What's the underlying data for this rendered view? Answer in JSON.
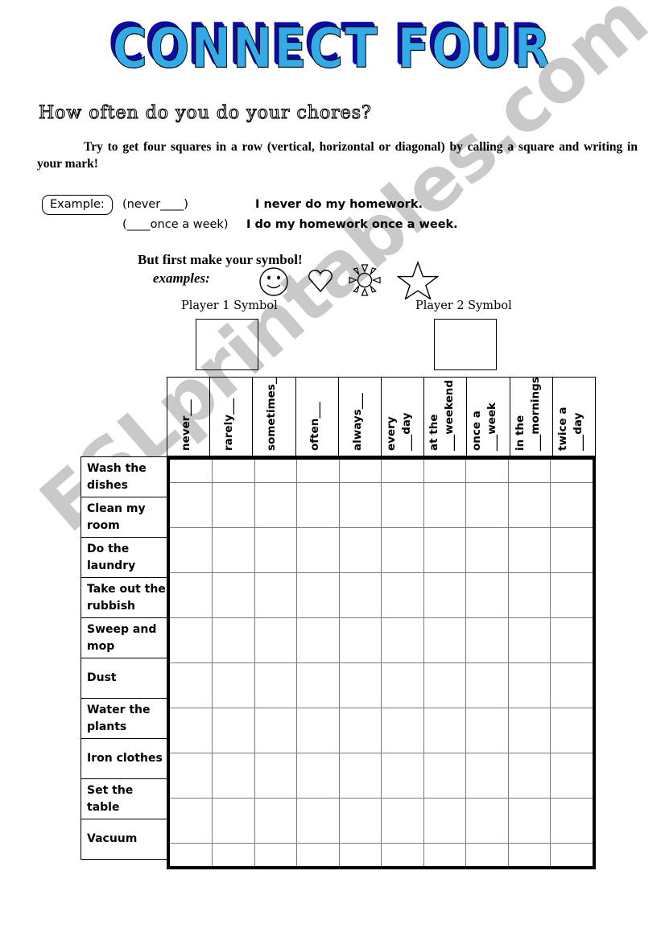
{
  "title": "CONNECT FOUR",
  "title_colors": {
    "fill": "#32ace8",
    "shadow": "#0b0ba6"
  },
  "question": "How often do you do your chores?",
  "instructions": "Try to get four squares in a row (vertical, horizontal or diagonal) by calling a square and writing in your mark!",
  "example": {
    "badge": "Example:",
    "cue_1": "(never____)",
    "cue_2": "(____once a week)",
    "sentence_1": "I never do my homework.",
    "sentence_2": "I do my homework once a week."
  },
  "symbols": {
    "title": "But first make your symbol!",
    "examples_label": "examples:",
    "icons": [
      "smiley-face-icon",
      "heart-icon",
      "sun-icon",
      "star-icon"
    ],
    "player1_label": "Player 1 Symbol",
    "player2_label": "Player 2 Symbol",
    "player1_value": "",
    "player2_value": ""
  },
  "grid": {
    "columns": [
      {
        "line1": "never",
        "line2": ""
      },
      {
        "line1": "rarely",
        "line2": ""
      },
      {
        "line1": "sometimes",
        "line2": ""
      },
      {
        "line1": "often",
        "line2": ""
      },
      {
        "line1": "always",
        "line2": ""
      },
      {
        "line1": "every",
        "line2": "day"
      },
      {
        "line1": "at the",
        "line2": "weekend"
      },
      {
        "line1": "once a",
        "line2": "week"
      },
      {
        "line1": "in the",
        "line2": "mornings"
      },
      {
        "line1": "twice a",
        "line2": "day"
      }
    ],
    "rows": [
      "Wash the dishes",
      "Clean my room",
      "Do the laundry",
      "Take out the rubbish",
      "Sweep and mop",
      "Dust",
      "Water the plants",
      "Iron clothes",
      "Set the table",
      "Vacuum"
    ],
    "cells": [
      [
        "",
        "",
        "",
        "",
        "",
        "",
        "",
        "",
        "",
        ""
      ],
      [
        "",
        "",
        "",
        "",
        "",
        "",
        "",
        "",
        "",
        ""
      ],
      [
        "",
        "",
        "",
        "",
        "",
        "",
        "",
        "",
        "",
        ""
      ],
      [
        "",
        "",
        "",
        "",
        "",
        "",
        "",
        "",
        "",
        ""
      ],
      [
        "",
        "",
        "",
        "",
        "",
        "",
        "",
        "",
        "",
        ""
      ],
      [
        "",
        "",
        "",
        "",
        "",
        "",
        "",
        "",
        "",
        ""
      ],
      [
        "",
        "",
        "",
        "",
        "",
        "",
        "",
        "",
        "",
        ""
      ],
      [
        "",
        "",
        "",
        "",
        "",
        "",
        "",
        "",
        "",
        ""
      ],
      [
        "",
        "",
        "",
        "",
        "",
        "",
        "",
        "",
        "",
        ""
      ],
      [
        "",
        "",
        "",
        "",
        "",
        "",
        "",
        "",
        "",
        ""
      ]
    ]
  },
  "watermark": "ESLprintables.com"
}
